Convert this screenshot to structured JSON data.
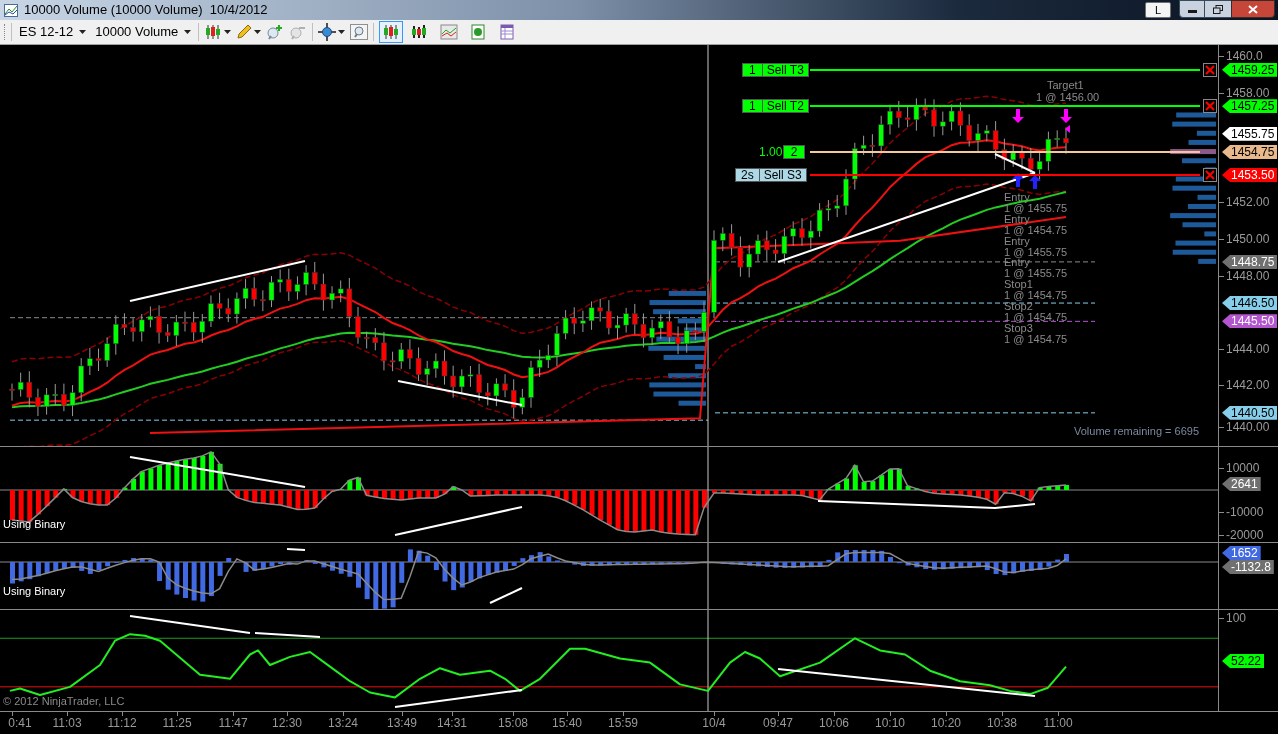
{
  "window": {
    "title": "10000 Volume (10000 Volume)  10/4/2012",
    "layout_button": "L"
  },
  "toolbar": {
    "instrument": "ES 12-12",
    "interval": "10000 Volume",
    "toggles": [
      {
        "selected": true
      },
      {
        "selected": false
      },
      {
        "selected": false
      },
      {
        "selected": false
      },
      {
        "selected": false
      }
    ]
  },
  "price_panel": {
    "order_lines": [
      {
        "kind": "target",
        "quantity": "1",
        "label": "Sell T3",
        "color": "#00ff00",
        "close_button": true
      },
      {
        "kind": "target",
        "quantity": "1",
        "label": "Sell T2",
        "color": "#00ff00",
        "close_button": true
      },
      {
        "kind": "position",
        "price_text": "1.00",
        "quantity": "2",
        "color": "#f5c79a",
        "close_button": false
      },
      {
        "kind": "stop",
        "quantity": "2s",
        "label": "Sell S3",
        "color": "#ff0000",
        "close_button": true
      }
    ],
    "annotations": [
      "Target1",
      "1 @ 1456.00",
      "Entry",
      "1 @ 1455.75",
      "Entry",
      "1 @ 1454.75",
      "Entry",
      "1 @ 1455.75",
      "Entry",
      "1 @ 1455.75",
      "Stop1",
      "1 @ 1454.75",
      "Stop2",
      "1 @ 1454.75",
      "Stop3",
      "1 @ 1454.75"
    ],
    "volume_remaining": "Volume remaining = 6695",
    "axis_ticks": [
      "1460.0",
      "1458.00",
      "1452.00",
      "1450.00",
      "1448.00",
      "1444.00",
      "1442.00",
      "1440.00"
    ],
    "price_flags": [
      {
        "text": "1459.25",
        "color": "#00ff00"
      },
      {
        "text": "1457.25",
        "color": "#00ff00"
      },
      {
        "text": "1455.75",
        "color": "#ffffff"
      },
      {
        "text": "1454.75",
        "color": "#e8b98c"
      },
      {
        "text": "1453.50",
        "color": "#ff0000"
      },
      {
        "text": "1448.75",
        "color": "#707070"
      },
      {
        "text": "1446.50",
        "color": "#87ceeb"
      },
      {
        "text": "1445.50",
        "color": "#b455d0"
      },
      {
        "text": "1440.50",
        "color": "#87ceeb"
      }
    ]
  },
  "indicator_panels": [
    {
      "kind": "histogram",
      "caption": "Using Binary",
      "axis_ticks": [
        "10000",
        "-10000",
        "-20000"
      ],
      "flags": [
        {
          "text": "2641",
          "color": "#707070"
        }
      ]
    },
    {
      "kind": "blue_histogram",
      "caption": "Using Binary",
      "flags": [
        {
          "text": "1652",
          "color": "#4169e1"
        },
        {
          "text": "-1132.8",
          "color": "#707070"
        }
      ]
    },
    {
      "kind": "oscillator",
      "axis_ticks": [
        "100"
      ],
      "flags": [
        {
          "text": "52.22",
          "color": "#00ff00"
        }
      ],
      "copyright": "© 2012 NinjaTrader, LLC"
    }
  ],
  "time_axis": [
    "0:41",
    "11:03",
    "11:12",
    "11:25",
    "11:47",
    "12:30",
    "13:24",
    "13:49",
    "14:31",
    "15:08",
    "15:40",
    "15:59",
    "10/4",
    "09:47",
    "10:06",
    "10:10",
    "10:20",
    "10:38",
    "11:00"
  ]
}
